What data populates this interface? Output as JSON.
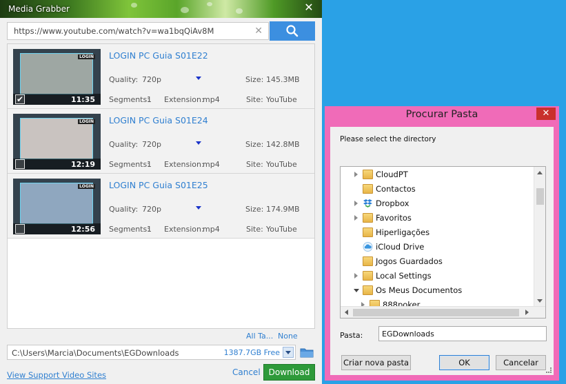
{
  "grabber": {
    "title": "Media Grabber",
    "close_glyph": "✕",
    "url_value": "https://www.youtube.com/watch?v=wa1bqQiAv8M",
    "clear_glyph": "✕",
    "labels": {
      "quality": "Quality:",
      "size": "Size:",
      "segments": "Segments:",
      "extension": "Extension:",
      "site": "Site:"
    },
    "items": [
      {
        "title": "LOGIN PC Guia S01E22",
        "duration": "11:35",
        "checked": "✔",
        "quality": "720p",
        "size": "145.3MB",
        "segments": "1",
        "extension": "mp4",
        "site": "YouTube",
        "logo": "LOGIN",
        "thumb_color": "#9ea7a3"
      },
      {
        "title": "LOGIN PC Guia S01E24",
        "duration": "12:19",
        "checked": "",
        "quality": "720p",
        "size": "142.8MB",
        "segments": "1",
        "extension": "mp4",
        "site": "YouTube",
        "logo": "LOGIN",
        "thumb_color": "#c9c3c0"
      },
      {
        "title": "LOGIN PC Guia S01E25",
        "duration": "12:56",
        "checked": "",
        "quality": "720p",
        "size": "174.9MB",
        "segments": "1",
        "extension": "mp4",
        "site": "YouTube",
        "logo": "LOGIN",
        "thumb_color": "#8fa7bf"
      }
    ],
    "all_label": "All Ta...",
    "none_label": "None",
    "path": "C:\\Users\\Marcia\\Documents\\EGDownloads",
    "free_space": "1387.7GB Free",
    "support_link": "View Support Video Sites",
    "cancel_label": "Cancel",
    "download_label": "Download",
    "accent": "#2f7fd0",
    "download_color": "#2e9a3a"
  },
  "dialog": {
    "title": "Procurar Pasta",
    "close_glyph": "✕",
    "prompt": "Please select the directory",
    "tree": [
      {
        "label": "CloudPT",
        "icon": "folder-icon",
        "expander": "collapsed"
      },
      {
        "label": "Contactos",
        "icon": "contacts-folder-icon",
        "expander": "none"
      },
      {
        "label": "Dropbox",
        "icon": "dropbox-icon",
        "expander": "collapsed"
      },
      {
        "label": "Favoritos",
        "icon": "favorites-folder-icon",
        "expander": "collapsed"
      },
      {
        "label": "Hiperligações",
        "icon": "links-folder-icon",
        "expander": "none"
      },
      {
        "label": "iCloud Drive",
        "icon": "icloud-icon",
        "expander": "none"
      },
      {
        "label": "Jogos Guardados",
        "icon": "saved-games-folder-icon",
        "expander": "none"
      },
      {
        "label": "Local Settings",
        "icon": "folder-icon",
        "expander": "collapsed"
      },
      {
        "label": "Os Meus Documentos",
        "icon": "documents-folder-icon",
        "expander": "expanded"
      },
      {
        "label": "888poker",
        "icon": "folder-icon",
        "expander": "collapsed",
        "child": true
      }
    ],
    "pasta_label": "Pasta:",
    "pasta_value": "EGDownloads",
    "new_folder_label": "Criar nova pasta",
    "ok_label": "OK",
    "cancel_label": "Cancelar",
    "frame_color": "#f06bb8"
  }
}
